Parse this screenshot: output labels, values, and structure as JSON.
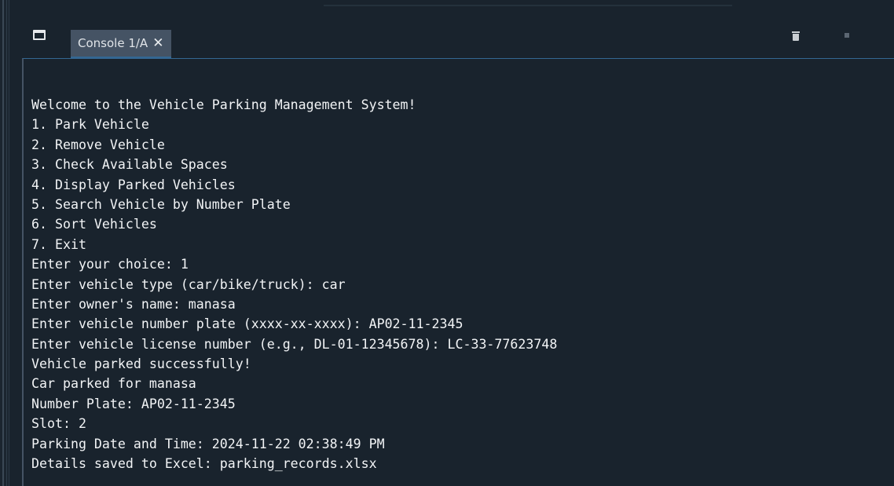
{
  "tab": {
    "label": "Console 1/A",
    "close_glyph": "✕"
  },
  "icons": {
    "pane": "window-pane-icon",
    "close": "close-icon",
    "trash": "trash-icon",
    "stop": "stop-icon"
  },
  "colors": {
    "background": "#19232d",
    "tab_active": "#455364",
    "accent": "#346792",
    "text": "#f2f4f6"
  },
  "console": {
    "lines": [
      "Welcome to the Vehicle Parking Management System!",
      "1. Park Vehicle",
      "2. Remove Vehicle",
      "3. Check Available Spaces",
      "4. Display Parked Vehicles",
      "5. Search Vehicle by Number Plate",
      "6. Sort Vehicles",
      "7. Exit",
      "Enter your choice: 1",
      "Enter vehicle type (car/bike/truck): car",
      "Enter owner's name: manasa",
      "Enter vehicle number plate (xxxx-xx-xxxx): AP02-11-2345",
      "Enter vehicle license number (e.g., DL-01-12345678): LC-33-77623748",
      "Vehicle parked successfully!",
      "Car parked for manasa",
      "Number Plate: AP02-11-2345",
      "Slot: 2",
      "Parking Date and Time: 2024-11-22 02:38:49 PM",
      "Details saved to Excel: parking_records.xlsx"
    ]
  }
}
